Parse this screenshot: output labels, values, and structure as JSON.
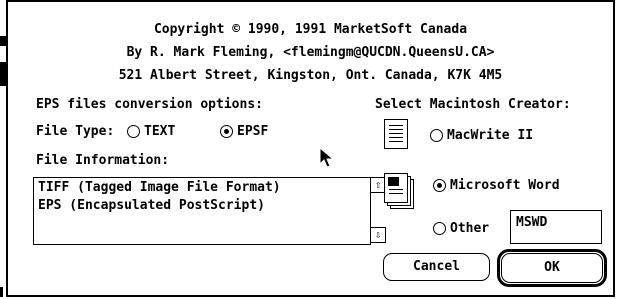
{
  "header": {
    "copyright": "Copyright © 1990, 1991 MarketSoft Canada",
    "author": "By R. Mark Fleming, <flemingm@QUCDN.QueensU.CA>",
    "address": "521 Albert Street, Kingston, Ont. Canada, K7K 4M5"
  },
  "options": {
    "eps_heading": "EPS files conversion options:",
    "creator_heading": "Select Macintosh Creator:"
  },
  "file_type": {
    "label": "File Type:",
    "text_option": "TEXT",
    "epsf_option": "EPSF",
    "selected": "EPSF"
  },
  "file_info": {
    "label": "File Information:",
    "lines": [
      "TIFF (Tagged Image File Format)",
      "EPS (Encapsulated PostScript)"
    ]
  },
  "creator": {
    "macwrite": "MacWrite II",
    "word": "Microsoft Word",
    "other": "Other",
    "selected": "Microsoft Word",
    "other_value": "MSWD"
  },
  "buttons": {
    "cancel": "Cancel",
    "ok": "OK"
  }
}
